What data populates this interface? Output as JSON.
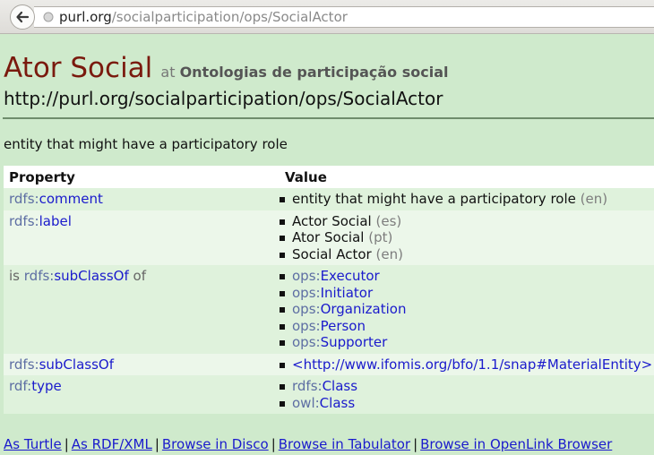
{
  "browser": {
    "url_host": "purl.org",
    "url_path": "/socialparticipation/ops/SocialActor",
    "back_icon": "arrow-left-icon",
    "site_icon": "globe-icon"
  },
  "page": {
    "title": "Ator Social",
    "at_label": "at",
    "ontology": "Ontologias de participação social",
    "uri": "http://purl.org/socialparticipation/ops/SocialActor",
    "description": "entity that might have a participatory role"
  },
  "table": {
    "headers": [
      "Property",
      "Value"
    ],
    "rows": [
      {
        "prefix_before": "",
        "prefix": "rdfs:",
        "property": "comment",
        "suffix": "",
        "values": [
          {
            "prefix": "",
            "text": "entity that might have a participatory role",
            "lang": "(en)",
            "link": false
          }
        ]
      },
      {
        "prefix_before": "",
        "prefix": "rdfs:",
        "property": "label",
        "suffix": "",
        "values": [
          {
            "prefix": "",
            "text": "Actor Social",
            "lang": "(es)",
            "link": false
          },
          {
            "prefix": "",
            "text": "Ator Social",
            "lang": "(pt)",
            "link": false
          },
          {
            "prefix": "",
            "text": "Social Actor",
            "lang": "(en)",
            "link": false
          }
        ]
      },
      {
        "prefix_before": "is ",
        "prefix": "rdfs:",
        "property": "subClassOf",
        "suffix": " of",
        "values": [
          {
            "prefix": "ops:",
            "text": "Executor",
            "lang": "",
            "link": true
          },
          {
            "prefix": "ops:",
            "text": "Initiator",
            "lang": "",
            "link": true
          },
          {
            "prefix": "ops:",
            "text": "Organization",
            "lang": "",
            "link": true
          },
          {
            "prefix": "ops:",
            "text": "Person",
            "lang": "",
            "link": true
          },
          {
            "prefix": "ops:",
            "text": "Supporter",
            "lang": "",
            "link": true
          }
        ]
      },
      {
        "prefix_before": "",
        "prefix": "rdfs:",
        "property": "subClassOf",
        "suffix": "",
        "values": [
          {
            "prefix": "",
            "text": "<http://www.ifomis.org/bfo/1.1/snap#MaterialEntity>",
            "lang": "",
            "link": true,
            "uri": true
          }
        ]
      },
      {
        "prefix_before": "",
        "prefix": "rdf:",
        "property": "type",
        "suffix": "",
        "values": [
          {
            "prefix": "rdfs:",
            "text": "Class",
            "lang": "",
            "link": true
          },
          {
            "prefix": "owl:",
            "text": "Class",
            "lang": "",
            "link": true
          }
        ]
      }
    ]
  },
  "footer": {
    "links": [
      "As Turtle",
      "As RDF/XML",
      "Browse in Disco",
      "Browse in Tabulator",
      "Browse in OpenLink Browser"
    ],
    "separator": "|"
  }
}
